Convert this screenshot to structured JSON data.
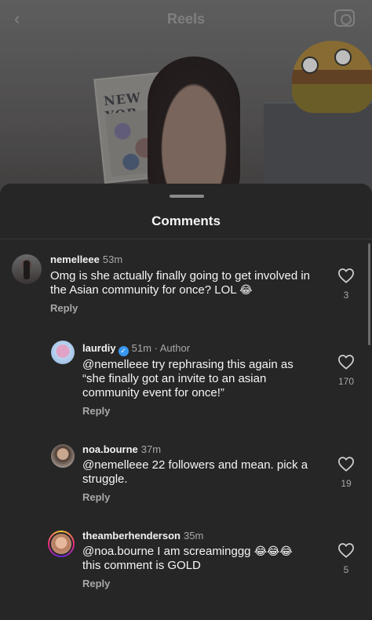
{
  "header": {
    "back_icon": "chevron-left-icon",
    "title": "Reels",
    "camera_icon": "camera-icon"
  },
  "sheet": {
    "title": "Comments"
  },
  "comments": [
    {
      "username": "nemelleee",
      "time": "53m",
      "author": "",
      "verified": false,
      "text_line1": "Omg is she actually finally going to get involved in",
      "text_line2": "the Asian community for once? LOL",
      "emoji": "😂",
      "reply": "Reply",
      "likes": "3"
    },
    {
      "username": "laurdiy",
      "time": "51m",
      "author": "Author",
      "verified": true,
      "text_line1": "@nemelleee try rephrasing this again as",
      "text_line2": "“she finally got an invite to an asian",
      "text_line3": "community event for once!”",
      "reply": "Reply",
      "likes": "170"
    },
    {
      "username": "noa.bourne",
      "time": "37m",
      "text_line1": "@nemelleee 22 followers and mean. pick a",
      "text_line2": "struggle.",
      "reply": "Reply",
      "likes": "19"
    },
    {
      "username": "theamberhenderson",
      "time": "35m",
      "text_line1": "@noa.bourne I am screaminggg",
      "emoji": "😂😂😂",
      "text_line2": "this comment is GOLD",
      "reply": "Reply",
      "likes": "5"
    }
  ],
  "colors": {
    "sheet_bg": "#262626",
    "text_primary": "#f5f5f5",
    "text_secondary": "#a8a8a8",
    "verified_blue": "#3897f0"
  }
}
